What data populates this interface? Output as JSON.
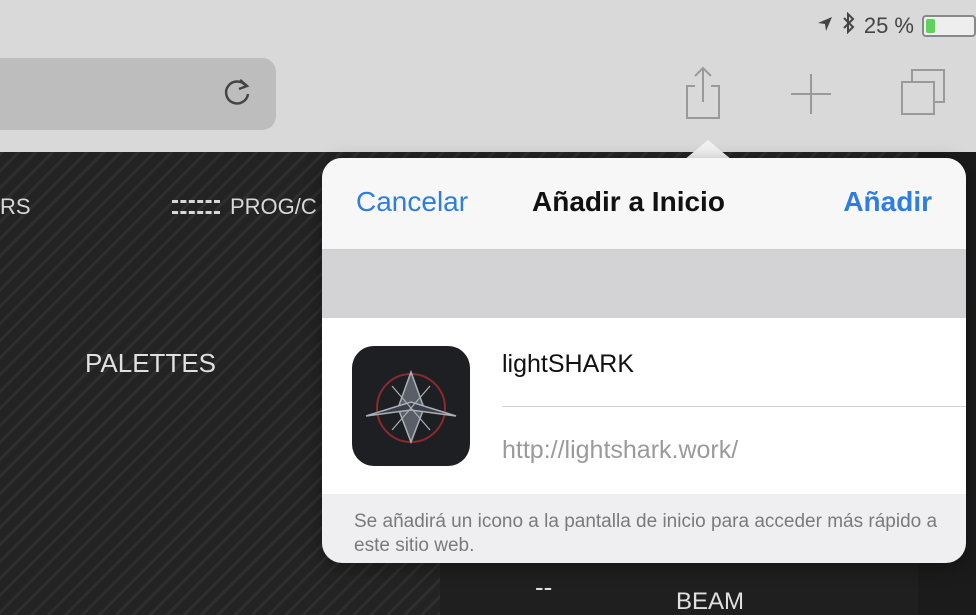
{
  "status": {
    "battery_text": "25 %",
    "battery_level": 0.25,
    "location_icon": "location-arrow-icon",
    "bluetooth_icon": "bluetooth-icon"
  },
  "toolbar": {
    "reload_icon": "reload-icon",
    "share_icon": "share-icon",
    "add_icon": "plus-icon",
    "tabs_icon": "tabs-icon"
  },
  "page": {
    "nav_rs": "RS",
    "nav_prog": "PROG/C",
    "palettes": "PALETTES",
    "dash": "--",
    "beam": "BEAM"
  },
  "dialog": {
    "cancel": "Cancelar",
    "title": "Añadir a Inicio",
    "add": "Añadir",
    "app_name": "lightSHARK",
    "app_url": "http://lightshark.work/",
    "footer": "Se añadirá un icono a la pantalla de inicio para acceder más rápido a este sitio web."
  },
  "colors": {
    "accent": "#2f7de0",
    "battery": "#5dd35a",
    "page_bg": "#232323"
  }
}
